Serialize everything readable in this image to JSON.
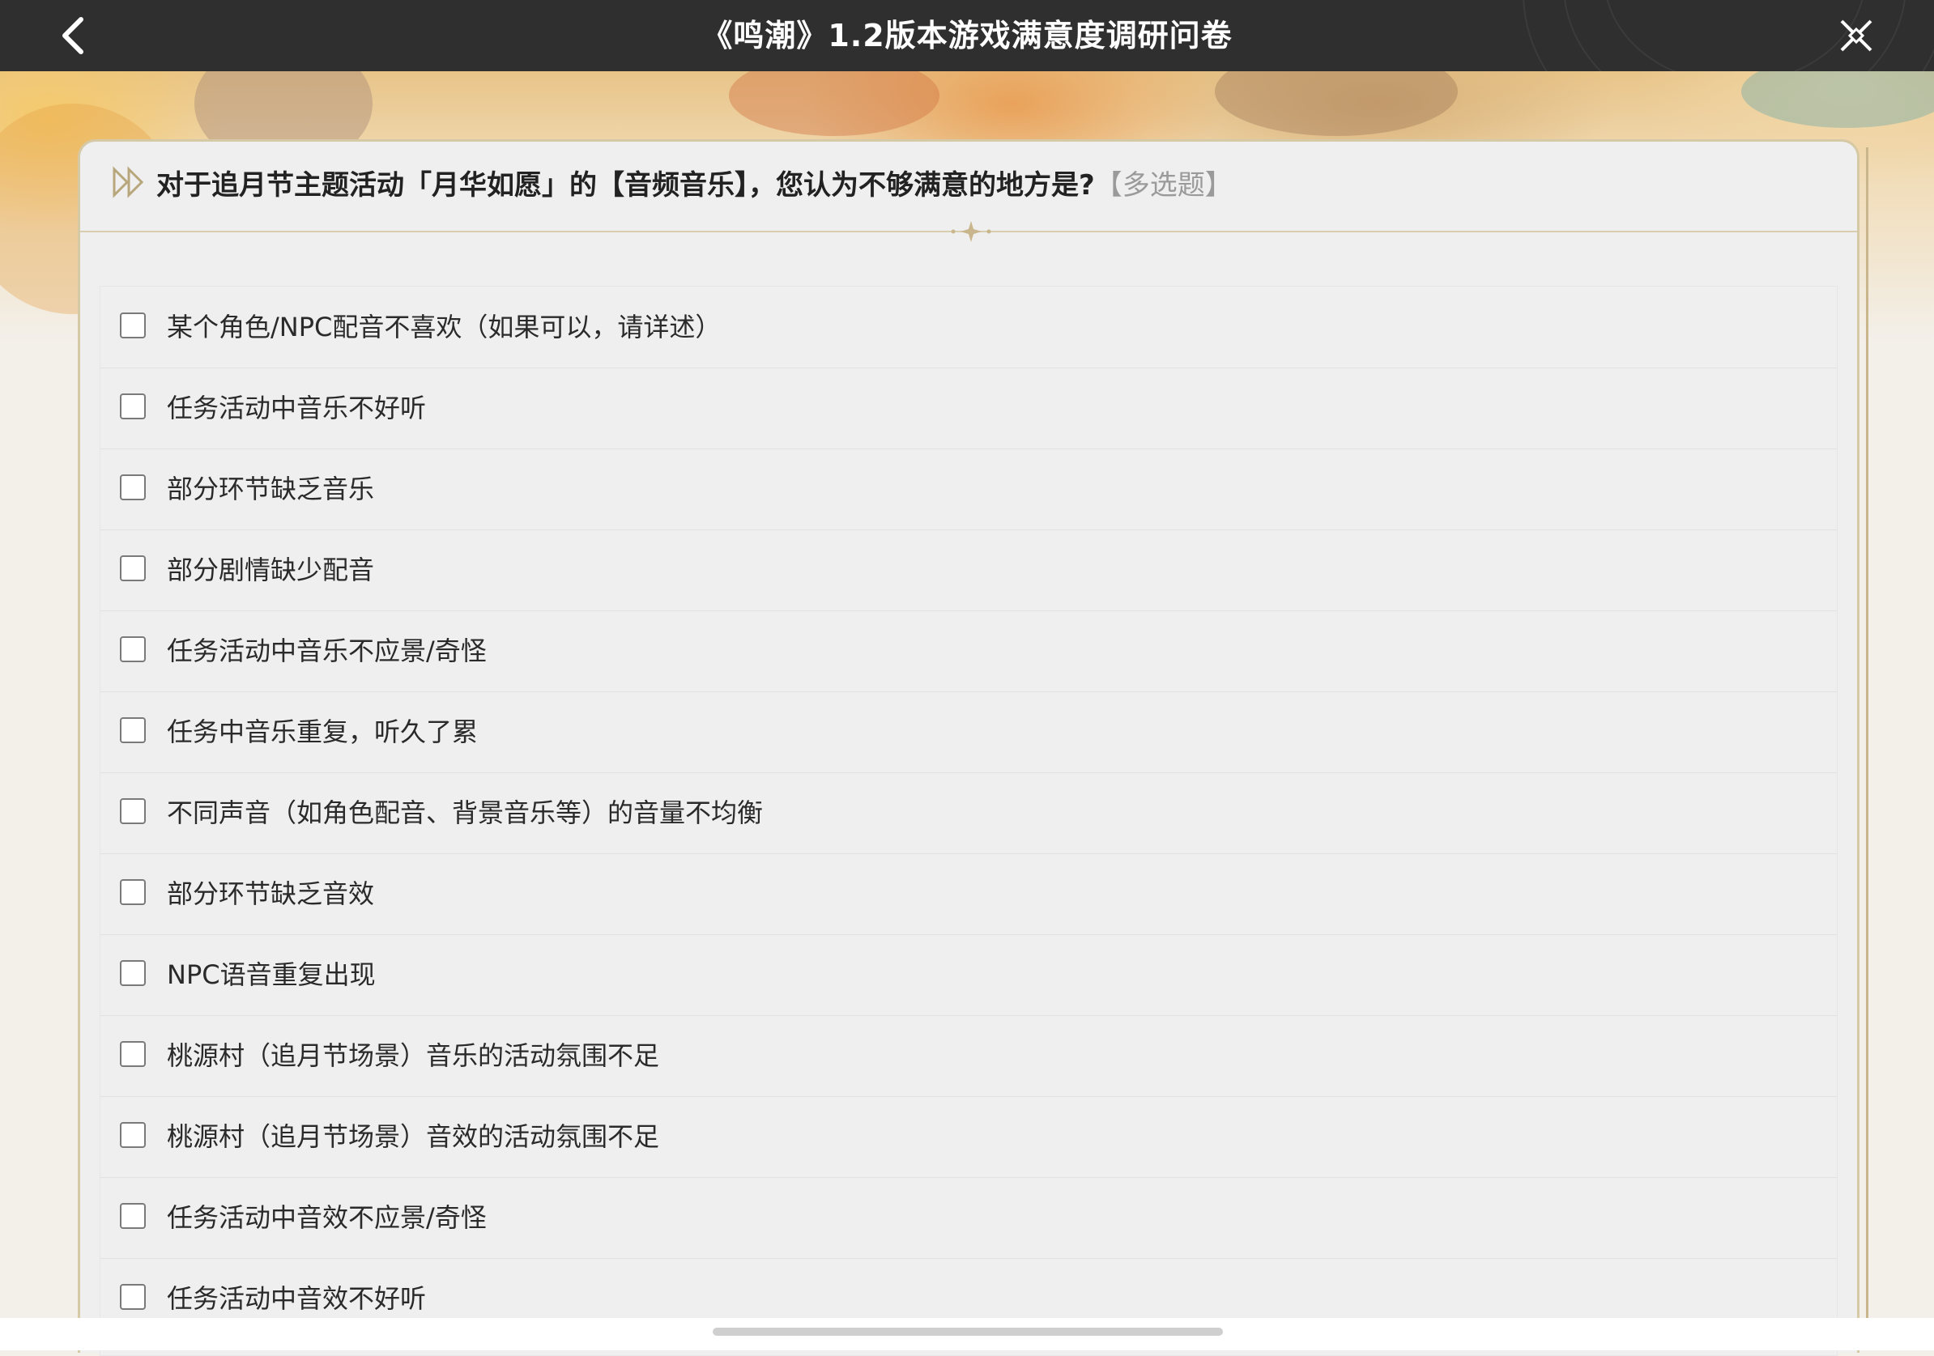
{
  "header": {
    "title": "《鸣潮》1.2版本游戏满意度调研问卷",
    "back_icon": "chevron-left-icon",
    "close_icon": "close-icon"
  },
  "question": {
    "text": "对于追月节主题活动「月华如愿」的【音频音乐】，您认为不够满意的地方是?",
    "tag": "【多选题】"
  },
  "options": [
    {
      "label": "某个角色/NPC配音不喜欢（如果可以，请详述）",
      "checked": false
    },
    {
      "label": "任务活动中音乐不好听",
      "checked": false
    },
    {
      "label": "部分环节缺乏音乐",
      "checked": false
    },
    {
      "label": "部分剧情缺少配音",
      "checked": false
    },
    {
      "label": "任务活动中音乐不应景/奇怪",
      "checked": false
    },
    {
      "label": "任务中音乐重复，听久了累",
      "checked": false
    },
    {
      "label": "不同声音（如角色配音、背景音乐等）的音量不均衡",
      "checked": false
    },
    {
      "label": "部分环节缺乏音效",
      "checked": false
    },
    {
      "label": "NPC语音重复出现",
      "checked": false
    },
    {
      "label": "桃源村（追月节场景）音乐的活动氛围不足",
      "checked": false
    },
    {
      "label": "桃源村（追月节场景）音效的活动氛围不足",
      "checked": false
    },
    {
      "label": "任务活动中音效不应景/奇怪",
      "checked": false
    },
    {
      "label": "任务活动中音效不好听",
      "checked": false
    }
  ],
  "colors": {
    "topbar": "#2f2f2f",
    "card_border": "#d6c9a6",
    "accent_gold": "#c9b68c",
    "tag_gray": "#9a9a9a"
  }
}
